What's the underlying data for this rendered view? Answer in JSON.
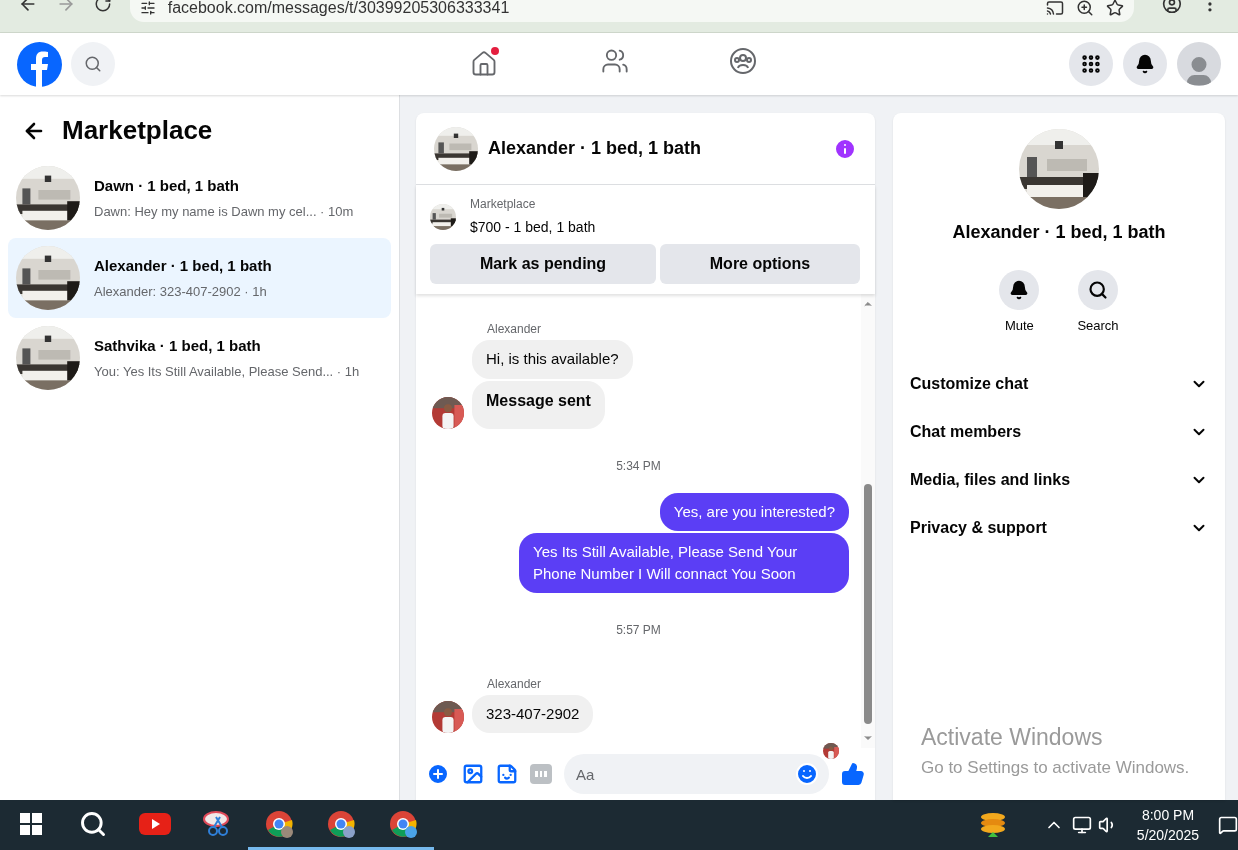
{
  "browser": {
    "url": "facebook.com/messages/t/30399205306333341"
  },
  "nav": {
    "home_badge": true
  },
  "sidebar": {
    "title": "Marketplace",
    "conversations": [
      {
        "name": "Dawn · 1 bed, 1 bath",
        "preview": "Dawn: Hey my name is Dawn my cel... · 10m",
        "selected": false
      },
      {
        "name": "Alexander · 1 bed, 1 bath",
        "preview": "Alexander: 323-407-2902 · 1h",
        "selected": true
      },
      {
        "name": "Sathvika · 1 bed, 1 bath",
        "preview": "You: Yes Its Still Available, Please Send... · 1h",
        "selected": false
      }
    ]
  },
  "chat": {
    "title": "Alexander · 1 bed, 1 bath",
    "listing": {
      "label": "Marketplace",
      "title": "$700 - 1 bed, 1 bath"
    },
    "actions": [
      "Mark as pending",
      "More options"
    ],
    "messages": [
      {
        "kind": "sender",
        "text": "Alexander"
      },
      {
        "kind": "incoming",
        "text": "Hi, is this available?",
        "avatar": false,
        "bold": false
      },
      {
        "kind": "incoming",
        "text": "Message sent",
        "avatar": true,
        "bold": true
      },
      {
        "kind": "timestamp",
        "text": "5:34 PM"
      },
      {
        "kind": "outgoing",
        "text": "Yes, are you interested?"
      },
      {
        "kind": "outgoing",
        "text": "Yes Its Still Available, Please Send Your Phone Number I Will connact You Soon"
      },
      {
        "kind": "timestamp",
        "text": "5:57 PM"
      },
      {
        "kind": "sender",
        "text": "Alexander"
      },
      {
        "kind": "incoming",
        "text": "323-407-2902",
        "avatar": true,
        "bold": false
      },
      {
        "kind": "read_receipt"
      }
    ],
    "composer": {
      "placeholder": "Aa"
    }
  },
  "details": {
    "title": "Alexander · 1 bed, 1 bath",
    "actions": [
      {
        "kind": "mute",
        "label": "Mute"
      },
      {
        "kind": "search",
        "label": "Search"
      }
    ],
    "sections": [
      {
        "label": "Customize chat",
        "expanded": false
      },
      {
        "label": "Chat members",
        "expanded": false
      },
      {
        "label": "Media, files and links",
        "expanded": false
      },
      {
        "label": "Privacy & support",
        "expanded": false
      }
    ]
  },
  "windows_notice": {
    "title": "Activate Windows",
    "subtitle": "Go to Settings to activate Windows."
  },
  "taskbar": {
    "apps": [
      {
        "kind": "start",
        "running": false
      },
      {
        "kind": "search",
        "running": false
      },
      {
        "kind": "youtube",
        "running": false
      },
      {
        "kind": "snip",
        "running": false
      },
      {
        "kind": "chrome",
        "running": true
      },
      {
        "kind": "chrome",
        "running": true
      },
      {
        "kind": "chrome",
        "running": true
      }
    ],
    "time": "8:00 PM",
    "date": "5/20/2025"
  }
}
